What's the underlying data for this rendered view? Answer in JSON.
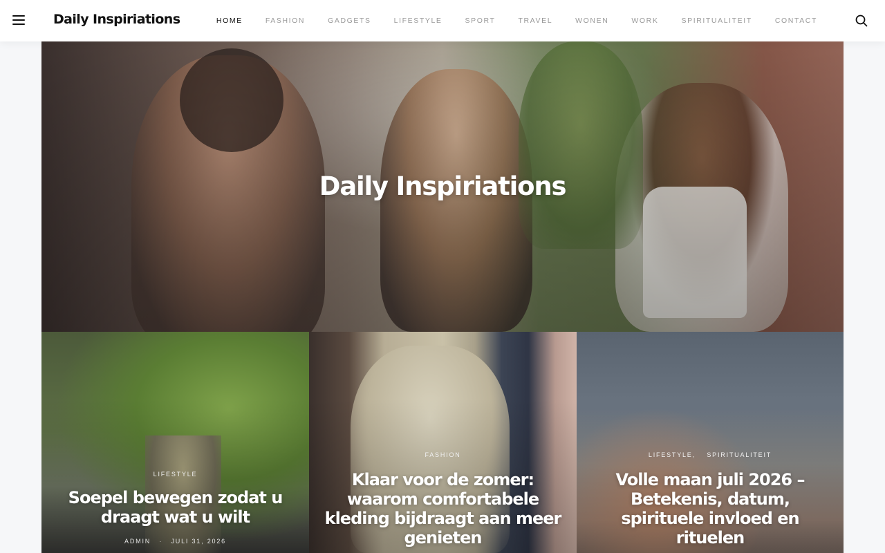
{
  "site": {
    "brand": "Daily Inspiriations"
  },
  "nav": {
    "items": [
      {
        "label": "HOME",
        "active": true
      },
      {
        "label": "FASHION"
      },
      {
        "label": "GADGETS"
      },
      {
        "label": "LIFESTYLE"
      },
      {
        "label": "SPORT"
      },
      {
        "label": "TRAVEL"
      },
      {
        "label": "WONEN"
      },
      {
        "label": "WORK"
      },
      {
        "label": "SPIRITUALITEIT"
      },
      {
        "label": "CONTACT"
      }
    ]
  },
  "icons": {
    "menu": "hamburger-menu-icon",
    "search": "search-icon"
  },
  "hero": {
    "title": "Daily Inspiriations"
  },
  "posts": [
    {
      "categories": [
        "LIFESTYLE"
      ],
      "title": "Soepel bewegen zodat u draagt wat u wilt",
      "author": "ADMIN",
      "date": "JULI 31, 2026"
    },
    {
      "categories": [
        "FASHION"
      ],
      "title": "Klaar voor de zomer: waarom comfortabele kleding bijdraagt aan meer genieten"
    },
    {
      "categories": [
        "LIFESTYLE,",
        "SPIRITUALITEIT"
      ],
      "title": "Volle maan juli 2026 – Betekenis, datum, spirituele invloed en rituelen"
    }
  ],
  "colors": {
    "text_dark": "#111111",
    "nav_muted": "#9a9a9a",
    "white": "#ffffff"
  }
}
